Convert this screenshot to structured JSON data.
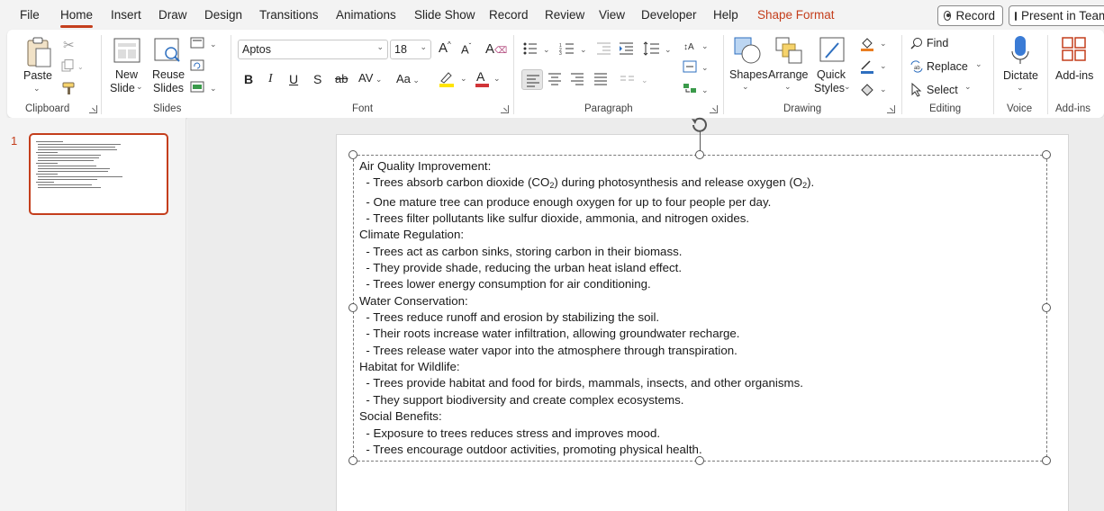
{
  "menubar": {
    "tabs": [
      "File",
      "Home",
      "Insert",
      "Draw",
      "Design",
      "Transitions",
      "Animations",
      "Slide Show",
      "Record",
      "Review",
      "View",
      "Developer",
      "Help",
      "Shape Format"
    ],
    "record_button": "Record",
    "present_button": "Present in Teams"
  },
  "ribbon": {
    "clipboard": {
      "paste": "Paste",
      "group": "Clipboard"
    },
    "slides": {
      "new_slide": "New",
      "new_slide2": "Slide",
      "reuse": "Reuse",
      "reuse2": "Slides",
      "group": "Slides"
    },
    "font": {
      "name": "Aptos",
      "size": "18",
      "group": "Font"
    },
    "paragraph": {
      "group": "Paragraph"
    },
    "drawing": {
      "shapes": "Shapes",
      "arrange": "Arrange",
      "quick_styles": "Quick",
      "quick_styles2": "Styles",
      "group": "Drawing"
    },
    "editing": {
      "find": "Find",
      "replace": "Replace",
      "select": "Select",
      "group": "Editing"
    },
    "voice": {
      "dictate": "Dictate",
      "group": "Voice"
    },
    "addins": {
      "label": "Add-ins",
      "group": "Add-ins"
    }
  },
  "thumbnails": {
    "slide_number": "1"
  },
  "slide": {
    "lines": [
      {
        "text": "Air Quality Improvement:"
      },
      {
        "text": "  - Trees absorb carbon dioxide (CO",
        "sub1": "2",
        "mid": ") during photosynthesis and release oxygen (O",
        "sub2": "2",
        "end": ")."
      },
      {
        "text": "  - One mature tree can produce enough oxygen for up to four people per day."
      },
      {
        "text": "  - Trees filter pollutants like sulfur dioxide, ammonia, and nitrogen oxides."
      },
      {
        "text": "Climate Regulation:"
      },
      {
        "text": "  - Trees act as carbon sinks, storing carbon in their biomass."
      },
      {
        "text": "  - They provide shade, reducing the urban heat island effect."
      },
      {
        "text": "  - Trees lower energy consumption for air conditioning."
      },
      {
        "text": "Water Conservation:"
      },
      {
        "text": "  - Trees reduce runoff and erosion by stabilizing the soil."
      },
      {
        "text": "  - Their roots increase water infiltration, allowing groundwater recharge."
      },
      {
        "text": "  - Trees release water vapor into the atmosphere through transpiration."
      },
      {
        "text": "Habitat for Wildlife:"
      },
      {
        "text": "  - Trees provide habitat and food for birds, mammals, insects, and other organisms."
      },
      {
        "text": "  - They support biodiversity and create complex ecosystems."
      },
      {
        "text": "Social Benefits:"
      },
      {
        "text": "  - Exposure to trees reduces stress and improves mood."
      },
      {
        "text": "  - Trees encourage outdoor activities, promoting physical health."
      }
    ]
  },
  "colors": {
    "accent": "#c43e1c",
    "ribbon_bg": "#ffffff",
    "app_bg": "#f3f3f3",
    "blue_icon": "#3a7bd5"
  }
}
